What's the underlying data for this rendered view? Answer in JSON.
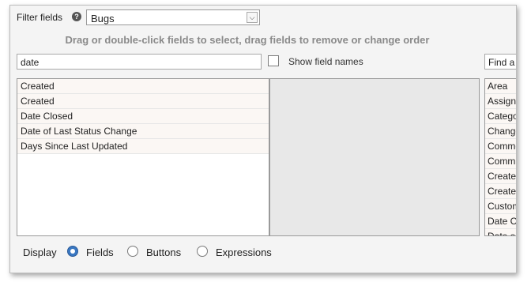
{
  "filter": {
    "label": "Filter fields",
    "help_icon": "question-circle-icon",
    "selected": "Bugs"
  },
  "instructions": "Drag or double-click fields to select, drag fields to remove or change order",
  "search": {
    "value": "date"
  },
  "show_field_names": {
    "label": "Show field names",
    "checked": false
  },
  "find": {
    "value": "Find a"
  },
  "left_list": [
    "Created",
    "Created",
    "Date Closed",
    "Date of Last Status Change",
    "Days Since Last Updated"
  ],
  "right_list": [
    "Area",
    "Assigne",
    "Catego",
    "Change",
    "Commen",
    "Comm",
    "Create",
    "Create",
    "Custom",
    "Date C",
    "Date o"
  ],
  "display": {
    "label": "Display",
    "options": [
      {
        "label": "Fields",
        "selected": true
      },
      {
        "label": "Buttons",
        "selected": false
      },
      {
        "label": "Expressions",
        "selected": false
      }
    ]
  }
}
